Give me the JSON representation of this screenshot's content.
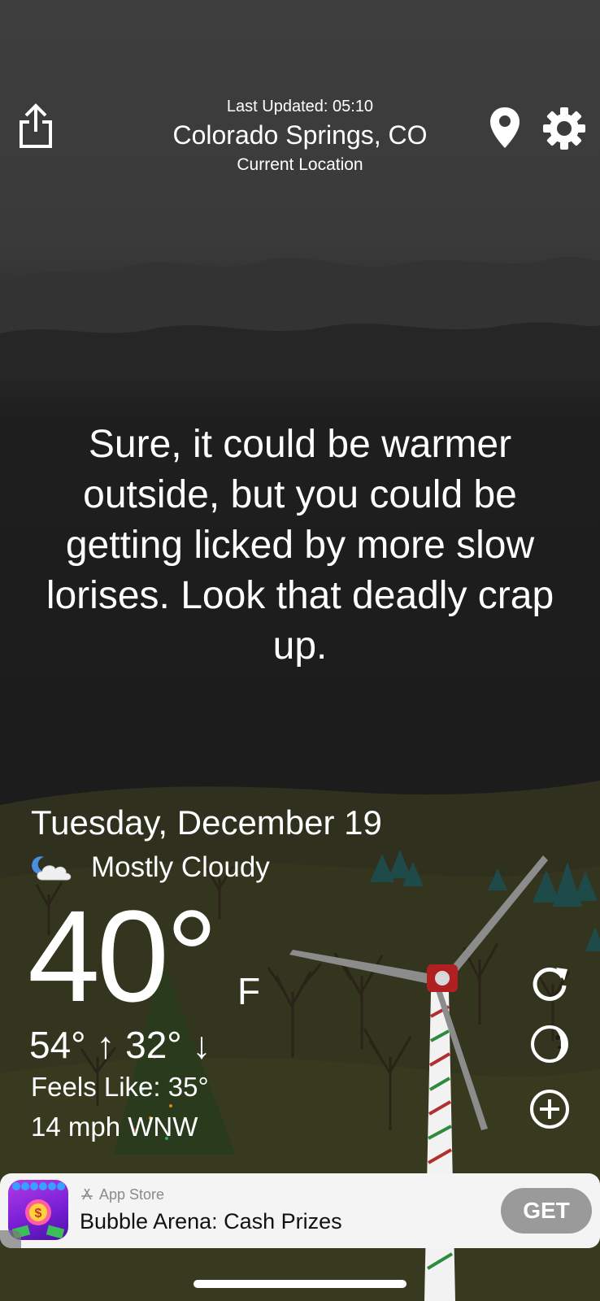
{
  "header": {
    "last_updated": "Last Updated: 05:10",
    "city": "Colorado Springs, CO",
    "location_label": "Current Location"
  },
  "quote": "Sure, it could be warmer outside, but you could be getting licked by more slow lorises. Look that deadly crap up.",
  "conditions": {
    "date": "Tuesday, December 19",
    "summary": "Mostly Cloudy",
    "summary_icon": "partly-cloudy-night-icon",
    "temperature": "40°",
    "unit": "F",
    "high_low": "54° ↑ 32° ↓",
    "feels_like": "Feels Like: 35°",
    "wind": "14 mph WNW"
  },
  "ad": {
    "store_label": "App Store",
    "title": "Bubble Arena: Cash Prizes",
    "cta": "GET"
  },
  "colors": {
    "sky_top": "#3e3e3e",
    "sky_bottom": "#1c1c1c",
    "ground": "#34351f",
    "ad_background": "#f4f4f4",
    "get_button": "#9a9a9a"
  }
}
